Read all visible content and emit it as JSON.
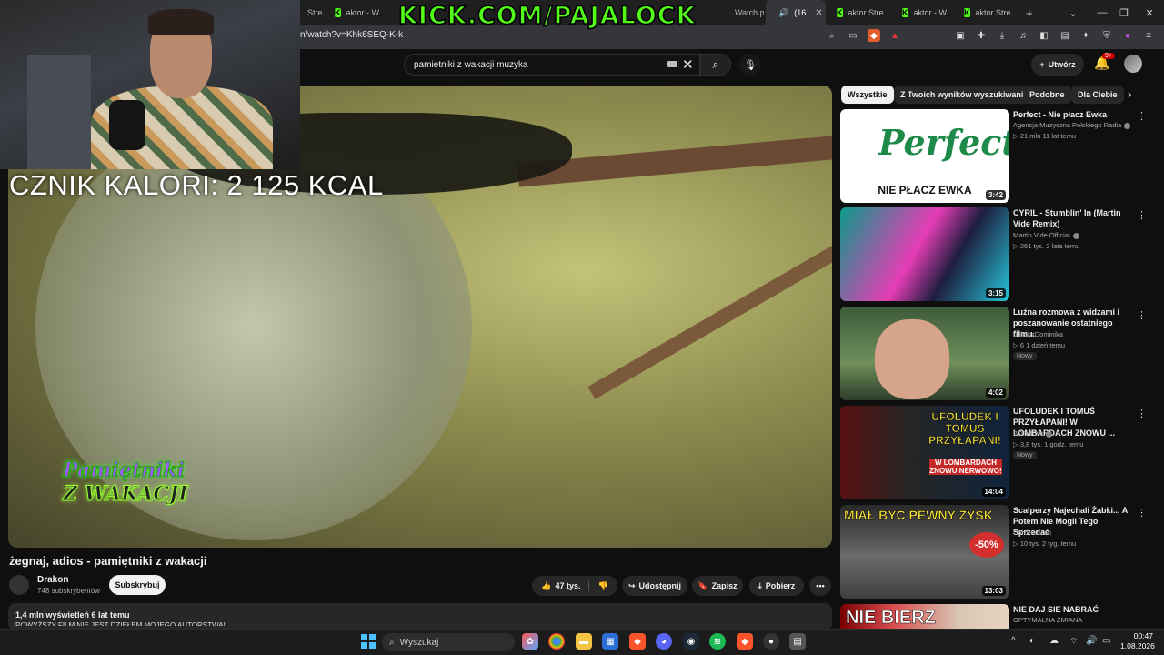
{
  "browser": {
    "tabs": [
      {
        "label": "Stre",
        "icon": "kick"
      },
      {
        "label": "aktor - W",
        "icon": "kick"
      },
      {
        "label": "(16",
        "icon": "youtube"
      },
      {
        "label": "aktor Stre",
        "icon": "kick"
      },
      {
        "label": "aktor - W",
        "icon": "kick"
      },
      {
        "label": "aktor Stre",
        "icon": "kick"
      }
    ],
    "url": "n/watch?v=Khk6SEQ-K-k"
  },
  "overlay": {
    "kick_url": "KICK.COM/PAJALOCK",
    "calorie_counter": "CZNIK KALORI: 2 125 KCAL"
  },
  "youtube": {
    "search_query": "pamietniki z wakacji muzyka",
    "create_label": "Utwórz",
    "notifications_badge": "9+"
  },
  "video": {
    "logo_line1": "Pamiętniki",
    "logo_line2": "Z WAKACJI",
    "title": "żegnaj, adios - pamiętniki z wakacji",
    "channel": "Drakon",
    "subscribers": "748 subskrybentów",
    "subscribe_label": "Subskrybuj",
    "likes": "47 tys.",
    "share_label": "Udostępnij",
    "save_label": "Zapisz",
    "download_label": "Pobierz",
    "stats": "1,4 mln wyświetleń  6 lat temu",
    "description": "POWYŻSZY FILM NIE JEST DZIEŁEM MOJEGO AUTORSTWA!"
  },
  "chips": [
    "Wszystkie",
    "Z Twoich wyników wyszukiwania",
    "Podobne",
    "Dla Ciebie"
  ],
  "recommendations": [
    {
      "title": "Perfect - Nie płacz Ewka",
      "channel": "Agencja Muzyczna Polskiego Radia",
      "meta": "▷ 21 mln  11 lat temu",
      "duration": "3:42",
      "thumb_text": "Perfect",
      "thumb_sub": "NIE PŁACZ EWKA",
      "badge": ""
    },
    {
      "title": "CYRIL - Stumblin' In (Martin Vide Remix)",
      "channel": "Martin Vide Official",
      "meta": "▷ 261 tys.  2 lata temu",
      "duration": "3:15",
      "badge": ""
    },
    {
      "title": "Luźna rozmowa z widzami i poszanowanie ostatniego filmu.",
      "channel": "ŁukaszDominika",
      "meta": "▷ 6  1 dzień temu",
      "duration": "4:02",
      "badge": "Nowy"
    },
    {
      "title": "UFOLUDEK I TOMUŚ PRZYŁAPANI! W LOMBARDACH ZNOWU ...",
      "channel": "BORBOtv",
      "meta": "▷ 3,8 tys.  1 godz. temu",
      "duration": "14:04",
      "thumb_text": "UFOLUDEK I TOMUŚ PRZYŁAPANI!",
      "thumb_sub": "W LOMBARDACH ZNOWU NERWOWO!",
      "badge": "Nowy"
    },
    {
      "title": "Scalperzy Najechali Żabki... A Potem Nie Mogli Tego Sprzedać",
      "channel": "CardHorizon",
      "meta": "▷ 10 tys.  2 tyg. temu",
      "duration": "13:03",
      "thumb_text": "MIAŁ BYĆ PEWNY ZYSK",
      "thumb_sub": "-50%",
      "badge": ""
    },
    {
      "title": "NIE DAJ SIE NABRAĆ",
      "channel": "OPTYMALNA ZMIANA",
      "meta": "",
      "duration": "",
      "thumb_text": "NIE BIERZ",
      "badge": ""
    }
  ],
  "taskbar": {
    "search_placeholder": "Wyszukaj",
    "time": "00:47",
    "date": "1.08.2026"
  }
}
